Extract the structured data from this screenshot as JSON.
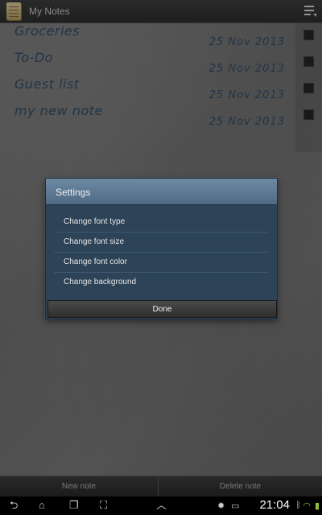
{
  "app": {
    "title": "My Notes"
  },
  "notes": [
    {
      "title": "Groceries",
      "date": "25 Nov 2013"
    },
    {
      "title": "To-Do",
      "date": "25 Nov 2013"
    },
    {
      "title": "Guest list",
      "date": "25 Nov 2013"
    },
    {
      "title": "my new note",
      "date": "25 Nov 2013"
    }
  ],
  "dialog": {
    "title": "Settings",
    "options": [
      "Change font type",
      "Change font size",
      "Change font color",
      "Change background"
    ],
    "done_label": "Done"
  },
  "bottom_buttons": {
    "new_note": "New note",
    "delete_note": "Delete note"
  },
  "system_bar": {
    "time": "21:04"
  },
  "colors": {
    "note_text": "#1f3b55",
    "dialog_bg": "#2d4357",
    "dialog_header": "#5d7893"
  }
}
